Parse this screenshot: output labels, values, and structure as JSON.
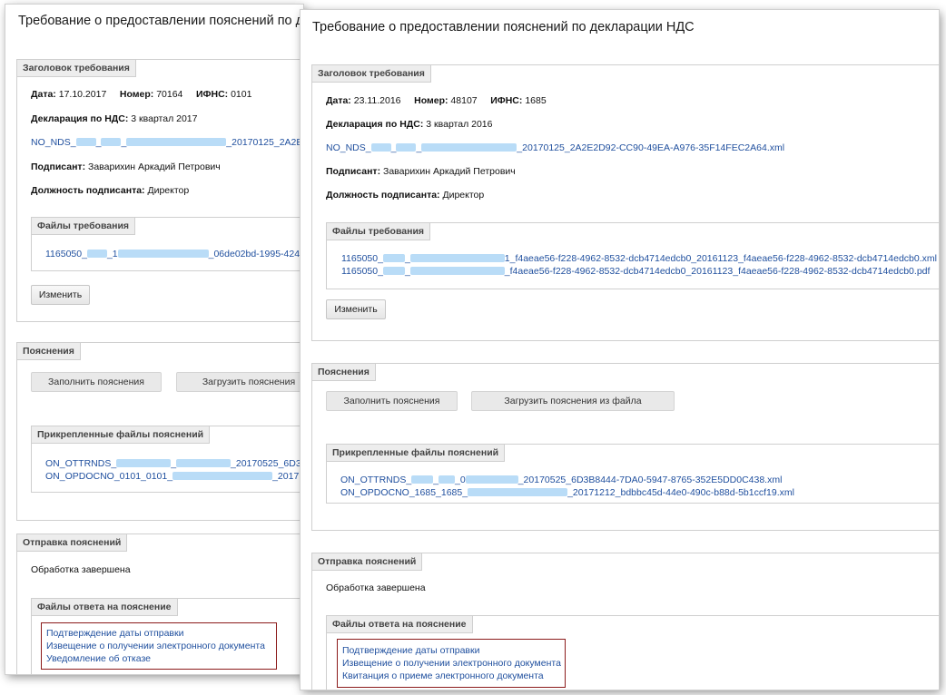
{
  "back": {
    "title": "Требование о предоставлении пояснений по д",
    "header_legend": "Заголовок требования",
    "date_label": "Дата:",
    "date": "17.10.2017",
    "number_label": "Номер:",
    "number": "70164",
    "ifns_label": "ИФНС:",
    "ifns": "0101",
    "decl_label": "Декларация по НДС:",
    "decl": "3 квартал 2017",
    "nds_file_a": "NO_NDS_",
    "nds_file_b": "_",
    "nds_file_c": "_",
    "nds_file_d": "_20170125_2A2E",
    "signer_label": "Подписант:",
    "signer": "Заварихин Аркадий Петрович",
    "position_label": "Должность подписанта:",
    "position": "Директор",
    "req_files_legend": "Файлы требования",
    "req_file_a": "1165050_",
    "req_file_b": "_1",
    "req_file_c": "_06de02bd-1995-424",
    "change_button": "Изменить",
    "expl_legend": "Пояснения",
    "fill_button": "Заполнить пояснения",
    "upload_button": "Загрузить пояснения",
    "attached_legend": "Прикрепленные файлы пояснений",
    "att_file1_a": "ON_OTTRNDS_",
    "att_file1_b": "_",
    "att_file1_c": "_20170525_6D3",
    "att_file2_a": "ON_OPDOCNO_0101_0101_",
    "att_file2_b": "_20171",
    "send_legend": "Отправка пояснений",
    "status": "Обработка завершена",
    "answer_legend": "Файлы ответа на пояснение",
    "answers": [
      "Подтверждение даты отправки",
      "Извещение о получении электронного документа",
      "Уведомление об отказе"
    ]
  },
  "front": {
    "title": "Требование о предоставлении пояснений по декларации НДС",
    "header_legend": "Заголовок требования",
    "date_label": "Дата:",
    "date": "23.11.2016",
    "number_label": "Номер:",
    "number": "48107",
    "ifns_label": "ИФНС:",
    "ifns": "1685",
    "decl_label": "Декларация по НДС:",
    "decl": "3 квартал 2016",
    "nds_file_a": "NO_NDS_",
    "nds_file_b": "_",
    "nds_file_c": "_",
    "nds_file_d": "_20170125_2A2E2D92-CC90-49EA-A976-35F14FEC2A64.xml",
    "signer_label": "Подписант:",
    "signer": "Заварихин Аркадий Петрович",
    "position_label": "Должность подписанта:",
    "position": "Директор",
    "req_files_legend": "Файлы требования",
    "req_file1_a": "1165050_",
    "req_file1_b": "_",
    "req_file1_c": "1_f4aeae56-f228-4962-8532-dcb4714edcb0_20161123_f4aeae56-f228-4962-8532-dcb4714edcb0.xml",
    "req_file2_a": "1165050_",
    "req_file2_b": "_",
    "req_file2_c": "_f4aeae56-f228-4962-8532-dcb4714edcb0_20161123_f4aeae56-f228-4962-8532-dcb4714edcb0.pdf",
    "change_button": "Изменить",
    "expl_legend": "Пояснения",
    "fill_button": "Заполнить пояснения",
    "upload_button": "Загрузить пояснения из файла",
    "attached_legend": "Прикрепленные файлы пояснений",
    "att_file1_a": "ON_OTTRNDS_",
    "att_file1_b": "_",
    "att_file1_c": "_0",
    "att_file1_d": "_20170525_6D3B8444-7DA0-5947-8765-352E5DD0C438.xml",
    "att_file2_a": "ON_OPDOCNO_1685_1685_",
    "att_file2_b": "_20171212_bdbbc45d-44e0-490c-b88d-5b1ccf19.xml",
    "send_legend": "Отправка пояснений",
    "status": "Обработка завершена",
    "answer_legend": "Файлы ответа на пояснение",
    "answers": [
      "Подтверждение даты отправки",
      "Извещение о получении электронного документа",
      "Квитанция о приеме электронного документа"
    ]
  },
  "colors": {
    "link": "#1f4f9e",
    "highlight_border": "#8b1a1a",
    "redacted": "#b9dcf7"
  }
}
